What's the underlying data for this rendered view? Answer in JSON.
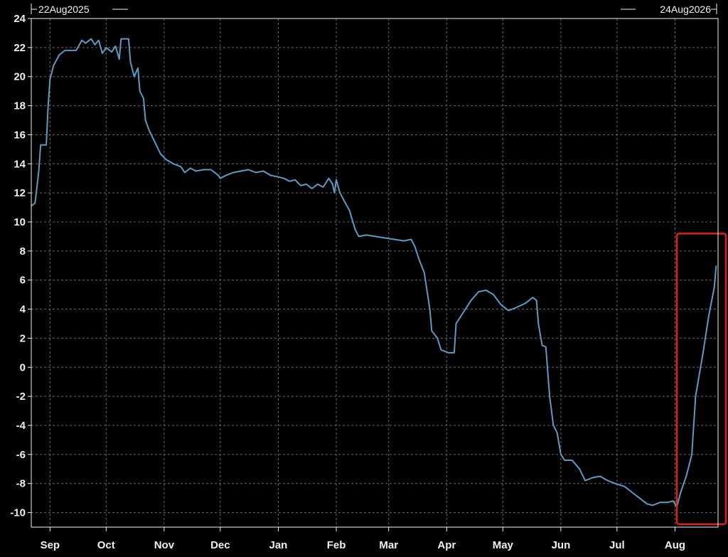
{
  "chart_data": {
    "type": "line",
    "start_date_label": "22Aug2025",
    "end_date_label": "24Aug2026",
    "ylim": [
      -11,
      24
    ],
    "y_ticks": [
      24,
      22,
      20,
      18,
      16,
      14,
      12,
      10,
      8,
      6,
      4,
      2,
      0,
      -2,
      -4,
      -6,
      -8,
      -10
    ],
    "x_tick_labels": [
      "Sep",
      "Oct",
      "Nov",
      "Dec",
      "Jan",
      "Feb",
      "Mar",
      "Apr",
      "May",
      "Jun",
      "Jul",
      "Aug"
    ],
    "x_tick_dates": [
      "2025-09-01",
      "2025-10-01",
      "2025-11-01",
      "2025-12-01",
      "2026-01-01",
      "2026-02-01",
      "2026-03-01",
      "2026-04-01",
      "2026-05-01",
      "2026-06-01",
      "2026-07-01",
      "2026-08-01"
    ],
    "xlim": [
      "2025-08-22",
      "2026-08-24"
    ],
    "grid": true,
    "colors": {
      "background": "#000000",
      "line": "#5b9bc4",
      "grid": "#6a6a6a",
      "axis": "#f2f2f2",
      "highlight_box": "#e0211d"
    },
    "series": [
      {
        "points": [
          [
            "2025-08-22",
            11.1
          ],
          [
            "2025-08-24",
            11.3
          ],
          [
            "2025-08-26",
            13.5
          ],
          [
            "2025-08-27",
            15.3
          ],
          [
            "2025-08-30",
            15.3
          ],
          [
            "2025-08-31",
            18.0
          ],
          [
            "2025-09-01",
            19.8
          ],
          [
            "2025-09-03",
            20.8
          ],
          [
            "2025-09-06",
            21.5
          ],
          [
            "2025-09-09",
            21.8
          ],
          [
            "2025-09-15",
            21.8
          ],
          [
            "2025-09-18",
            22.5
          ],
          [
            "2025-09-20",
            22.3
          ],
          [
            "2025-09-23",
            22.6
          ],
          [
            "2025-09-25",
            22.2
          ],
          [
            "2025-09-27",
            22.5
          ],
          [
            "2025-09-29",
            21.6
          ],
          [
            "2025-10-01",
            22.0
          ],
          [
            "2025-10-04",
            21.7
          ],
          [
            "2025-10-06",
            22.1
          ],
          [
            "2025-10-08",
            21.2
          ],
          [
            "2025-10-09",
            22.6
          ],
          [
            "2025-10-13",
            22.6
          ],
          [
            "2025-10-14",
            21.0
          ],
          [
            "2025-10-16",
            20.0
          ],
          [
            "2025-10-18",
            20.6
          ],
          [
            "2025-10-19",
            19.0
          ],
          [
            "2025-10-21",
            18.5
          ],
          [
            "2025-10-22",
            17.0
          ],
          [
            "2025-10-24",
            16.3
          ],
          [
            "2025-10-27",
            15.5
          ],
          [
            "2025-10-30",
            14.7
          ],
          [
            "2025-11-02",
            14.3
          ],
          [
            "2025-11-06",
            14.0
          ],
          [
            "2025-11-10",
            13.8
          ],
          [
            "2025-11-12",
            13.4
          ],
          [
            "2025-11-15",
            13.7
          ],
          [
            "2025-11-18",
            13.5
          ],
          [
            "2025-11-22",
            13.6
          ],
          [
            "2025-11-26",
            13.6
          ],
          [
            "2025-11-30",
            13.2
          ],
          [
            "2025-12-01",
            13.0
          ],
          [
            "2025-12-04",
            13.2
          ],
          [
            "2025-12-08",
            13.4
          ],
          [
            "2025-12-12",
            13.5
          ],
          [
            "2025-12-16",
            13.6
          ],
          [
            "2025-12-20",
            13.4
          ],
          [
            "2025-12-24",
            13.5
          ],
          [
            "2025-12-28",
            13.2
          ],
          [
            "2026-01-01",
            13.1
          ],
          [
            "2026-01-04",
            13.0
          ],
          [
            "2026-01-07",
            12.8
          ],
          [
            "2026-01-10",
            12.9
          ],
          [
            "2026-01-13",
            12.5
          ],
          [
            "2026-01-16",
            12.6
          ],
          [
            "2026-01-19",
            12.3
          ],
          [
            "2026-01-22",
            12.6
          ],
          [
            "2026-01-25",
            12.4
          ],
          [
            "2026-01-28",
            13.0
          ],
          [
            "2026-01-30",
            12.6
          ],
          [
            "2026-01-31",
            12.0
          ],
          [
            "2026-02-01",
            12.9
          ],
          [
            "2026-02-03",
            12.0
          ],
          [
            "2026-02-05",
            11.5
          ],
          [
            "2026-02-08",
            10.8
          ],
          [
            "2026-02-11",
            9.5
          ],
          [
            "2026-02-13",
            9.0
          ],
          [
            "2026-02-17",
            9.1
          ],
          [
            "2026-02-22",
            9.0
          ],
          [
            "2026-02-27",
            8.9
          ],
          [
            "2026-03-04",
            8.8
          ],
          [
            "2026-03-09",
            8.7
          ],
          [
            "2026-03-13",
            8.8
          ],
          [
            "2026-03-15",
            8.3
          ],
          [
            "2026-03-17",
            7.5
          ],
          [
            "2026-03-20",
            6.5
          ],
          [
            "2026-03-23",
            4.0
          ],
          [
            "2026-03-24",
            2.5
          ],
          [
            "2026-03-27",
            2.0
          ],
          [
            "2026-03-29",
            1.2
          ],
          [
            "2026-04-02",
            1.0
          ],
          [
            "2026-04-05",
            1.0
          ],
          [
            "2026-04-06",
            3.0
          ],
          [
            "2026-04-10",
            3.8
          ],
          [
            "2026-04-14",
            4.6
          ],
          [
            "2026-04-18",
            5.2
          ],
          [
            "2026-04-22",
            5.3
          ],
          [
            "2026-04-26",
            5.0
          ],
          [
            "2026-04-30",
            4.3
          ],
          [
            "2026-05-04",
            3.9
          ],
          [
            "2026-05-08",
            4.1
          ],
          [
            "2026-05-13",
            4.4
          ],
          [
            "2026-05-17",
            4.8
          ],
          [
            "2026-05-19",
            4.6
          ],
          [
            "2026-05-20",
            3.0
          ],
          [
            "2026-05-22",
            1.5
          ],
          [
            "2026-05-24",
            1.4
          ],
          [
            "2026-05-26",
            -2.0
          ],
          [
            "2026-05-28",
            -4.0
          ],
          [
            "2026-05-30",
            -4.5
          ],
          [
            "2026-06-01",
            -6.0
          ],
          [
            "2026-06-03",
            -6.4
          ],
          [
            "2026-06-07",
            -6.4
          ],
          [
            "2026-06-11",
            -7.0
          ],
          [
            "2026-06-14",
            -7.8
          ],
          [
            "2026-06-18",
            -7.6
          ],
          [
            "2026-06-22",
            -7.5
          ],
          [
            "2026-06-26",
            -7.8
          ],
          [
            "2026-06-30",
            -8.0
          ],
          [
            "2026-07-05",
            -8.2
          ],
          [
            "2026-07-09",
            -8.6
          ],
          [
            "2026-07-13",
            -9.0
          ],
          [
            "2026-07-17",
            -9.4
          ],
          [
            "2026-07-20",
            -9.5
          ],
          [
            "2026-07-24",
            -9.3
          ],
          [
            "2026-07-28",
            -9.3
          ],
          [
            "2026-07-31",
            -9.2
          ],
          [
            "2026-08-02",
            -9.6
          ],
          [
            "2026-08-04",
            -8.6
          ],
          [
            "2026-08-07",
            -7.5
          ],
          [
            "2026-08-10",
            -6.0
          ],
          [
            "2026-08-12",
            -2.0
          ],
          [
            "2026-08-16",
            1.0
          ],
          [
            "2026-08-19",
            3.5
          ],
          [
            "2026-08-22",
            5.5
          ],
          [
            "2026-08-23",
            7.0
          ]
        ]
      }
    ],
    "highlight_box": {
      "x_range": [
        "2026-08-02",
        "2026-08-24"
      ],
      "y_range": [
        -10.8,
        9.2
      ]
    }
  }
}
